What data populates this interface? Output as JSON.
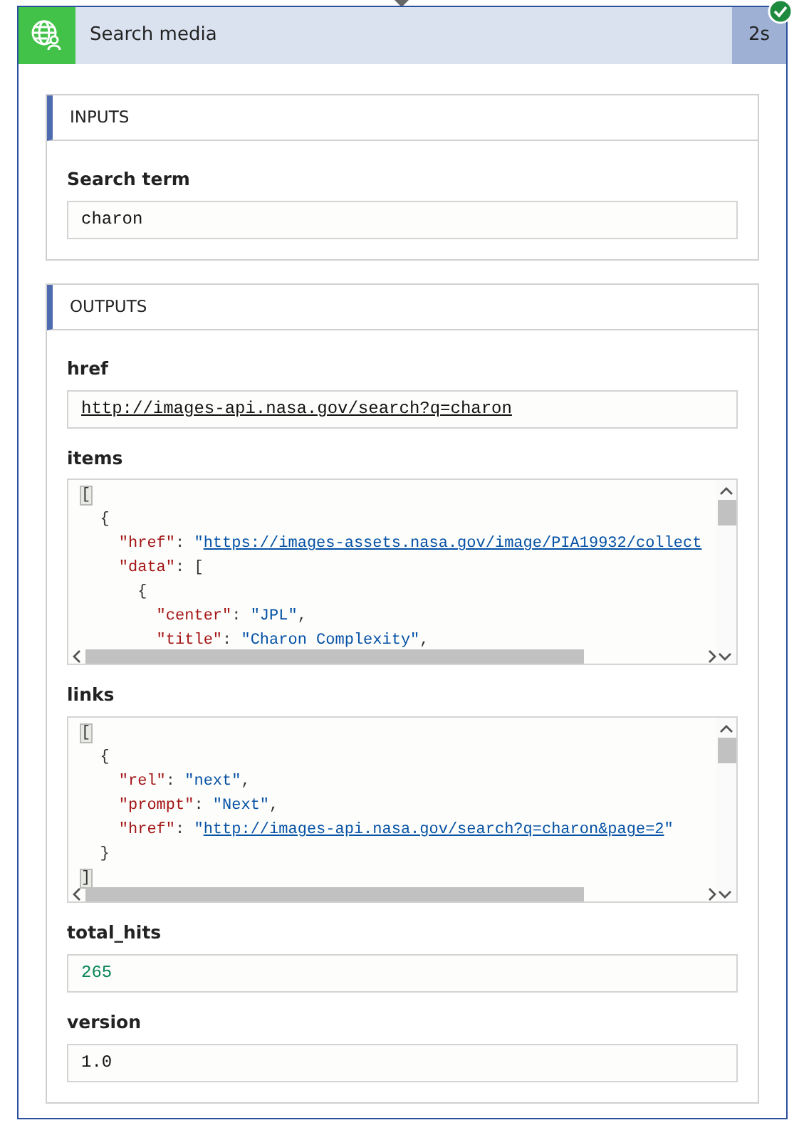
{
  "action": {
    "title": "Search media",
    "duration": "2s",
    "succeeded": true
  },
  "sections": [
    {
      "title": "INPUTS",
      "fields": [
        {
          "label": "Search term",
          "kind": "text",
          "value": "charon"
        }
      ]
    },
    {
      "title": "OUTPUTS",
      "fields": [
        {
          "label": "href",
          "kind": "link",
          "value": "http://images-api.nasa.gov/search?q=charon"
        },
        {
          "label": "items",
          "kind": "code",
          "lines": [
            [
              {
                "kind": "bracket",
                "text": "["
              }
            ],
            [
              {
                "kind": "punct",
                "text": "  {"
              }
            ],
            [
              {
                "kind": "key",
                "text": "    \"href\""
              },
              {
                "kind": "punct",
                "text": ": "
              },
              {
                "kind": "string",
                "text": "\""
              },
              {
                "kind": "link",
                "text": "https://images-assets.nasa.gov/image/PIA19932/collect"
              }
            ],
            [
              {
                "kind": "key",
                "text": "    \"data\""
              },
              {
                "kind": "punct",
                "text": ": ["
              }
            ],
            [
              {
                "kind": "punct",
                "text": "      {"
              }
            ],
            [
              {
                "kind": "key",
                "text": "        \"center\""
              },
              {
                "kind": "punct",
                "text": ": "
              },
              {
                "kind": "string",
                "text": "\"JPL\""
              },
              {
                "kind": "punct",
                "text": ","
              }
            ],
            [
              {
                "kind": "key",
                "text": "        \"title\""
              },
              {
                "kind": "punct",
                "text": ": "
              },
              {
                "kind": "string",
                "text": "\"Charon Complexity\""
              },
              {
                "kind": "punct",
                "text": ","
              }
            ]
          ]
        },
        {
          "label": "links",
          "kind": "code",
          "lines": [
            [
              {
                "kind": "bracket",
                "text": "["
              }
            ],
            [
              {
                "kind": "punct",
                "text": "  {"
              }
            ],
            [
              {
                "kind": "key",
                "text": "    \"rel\""
              },
              {
                "kind": "punct",
                "text": ": "
              },
              {
                "kind": "string",
                "text": "\"next\""
              },
              {
                "kind": "punct",
                "text": ","
              }
            ],
            [
              {
                "kind": "key",
                "text": "    \"prompt\""
              },
              {
                "kind": "punct",
                "text": ": "
              },
              {
                "kind": "string",
                "text": "\"Next\""
              },
              {
                "kind": "punct",
                "text": ","
              }
            ],
            [
              {
                "kind": "key",
                "text": "    \"href\""
              },
              {
                "kind": "punct",
                "text": ": "
              },
              {
                "kind": "string",
                "text": "\""
              },
              {
                "kind": "link",
                "text": "http://images-api.nasa.gov/search?q=charon&page=2"
              },
              {
                "kind": "string",
                "text": "\""
              }
            ],
            [
              {
                "kind": "punct",
                "text": "  }"
              }
            ],
            [
              {
                "kind": "bracket",
                "text": "]"
              }
            ]
          ]
        },
        {
          "label": "total_hits",
          "kind": "number",
          "value": "265"
        },
        {
          "label": "version",
          "kind": "text",
          "value": "1.0"
        }
      ]
    }
  ]
}
